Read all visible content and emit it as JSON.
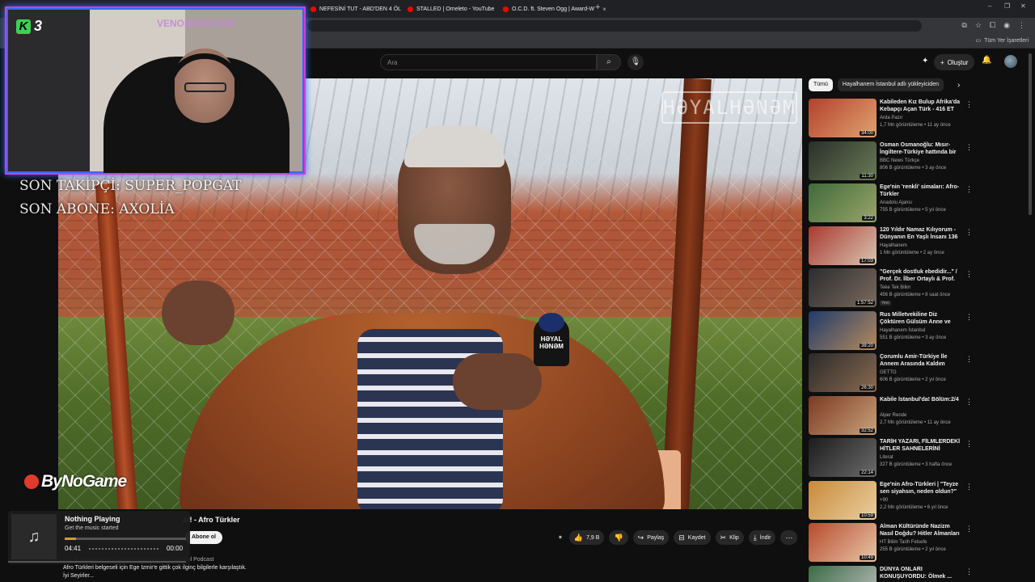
{
  "browser": {
    "tabs": [
      {
        "title": "NEFESİNİ TUT - ABD'DEN 4 ÖL"
      },
      {
        "title": "STALLED | Omeleto - YouTube"
      },
      {
        "title": "O.C.D. ft. Steven Ogg | Award-W"
      }
    ],
    "tab_close": "×",
    "new_tab": "+",
    "window_controls": {
      "minimize": "–",
      "restore": "❐",
      "close": "✕"
    },
    "bookmarks_label": "Tüm Yer İşaretleri"
  },
  "youtube": {
    "search_placeholder": "Ara",
    "create_label": "Oluştur",
    "video_watermark": "HƏYALHƏNƏM",
    "mic_flag": "HƏYAL HƏNƏM",
    "video_title": "ar! - Afro Türkler",
    "subscribe_label": "Abone ol",
    "actions": [
      {
        "icon": "like-icon",
        "glyph": "👍",
        "label": "7,9 B"
      },
      {
        "icon": "dislike-icon",
        "glyph": "👎",
        "label": ""
      },
      {
        "icon": "share-icon",
        "glyph": "↪",
        "label": "Paylaş"
      },
      {
        "icon": "save-icon",
        "glyph": "⊟",
        "label": "Kaydet"
      },
      {
        "icon": "clip-icon",
        "glyph": "✂",
        "label": "Klip"
      },
      {
        "icon": "download-icon",
        "glyph": "⤓",
        "label": "İndir"
      },
      {
        "icon": "more-icon",
        "glyph": "⋯",
        "label": ""
      }
    ],
    "description_meta": "574 B görüntüleme  2 ay önce  Hayalhanem İstanbul Podcast",
    "description_line1": "Afro Türkleri belgeseli için Ege İzmir'e gittik çok ilginç bilgilerle karşılaştık.",
    "description_line2": "İyi Seyirler..."
  },
  "stream_overlay": {
    "kick_number": "3",
    "kick_letter": "K",
    "channel_name": "VENOMSOKHAN",
    "last_follower": "SON TAKİPÇİ: SUPER_POPGAT",
    "last_subscriber": "SON ABONE: AXOLİA",
    "sponsor": "ByNoGame"
  },
  "now_playing": {
    "title": "Nothing Playing",
    "subtitle": "Get the music started",
    "elapsed": "04:41",
    "total": "00:00",
    "progress": 0.09
  },
  "sidebar": {
    "chips": [
      "Tümü",
      "Hayalhanem İstanbul adlı yükleyiciden"
    ],
    "recommendations": [
      {
        "title": "Kabileden Kız Bulup Afrika'da Kebapçı Açan Türk - 416 ET",
        "channel": "Arda Pazır",
        "meta": "1,7 Mn görüntüleme • 11 ay önce",
        "duration": "34:00",
        "c1": "#b3412c",
        "c2": "#e0a36f"
      },
      {
        "title": "Osman Osmanoğlu: Mısır-İngiltere-Türkiye hattında bir ...",
        "channel": "BBC News Türkçe",
        "meta": "806 B görüntüleme • 3 ay önce",
        "duration": "11:30",
        "c1": "#2a2f2a",
        "c2": "#6a7b55"
      },
      {
        "title": "Ege'nin 'renkli' simaları: Afro-Türkler",
        "channel": "Anadolu Ajansı",
        "meta": "755 B görüntüleme • 5 yıl önce",
        "duration": "3:22",
        "c1": "#3f6b3a",
        "c2": "#9aa46a"
      },
      {
        "title": "120 Yıldır Namaz Kılıyorum - Dünyanın En Yaşlı İnsanı 136 ...",
        "channel": "Hayalhanem",
        "meta": "1 Mn görüntüleme • 2 ay önce",
        "duration": "17:03",
        "c1": "#a93a30",
        "c2": "#d9c4b0"
      },
      {
        "title": "\"Gerçek dostluk ebedidir...\" / Prof. Dr. İlber Ortaylı & Prof. Dr...",
        "channel": "Teke Tek Bilim",
        "meta": "456 B görüntüleme • 8 saat önce",
        "duration": "1:57:52",
        "badge": "Yeni",
        "c1": "#2c2c30",
        "c2": "#7a6a5c"
      },
      {
        "title": "Rus Milletvekiline Diz Çöktüren Gülsüm Anne ve Umut'un ...",
        "channel": "Hayalhanem İstanbul",
        "meta": "551 B görüntüleme • 3 ay önce",
        "duration": "38:20",
        "c1": "#1f3b6b",
        "c2": "#b58a5c"
      },
      {
        "title": "Çorumlu Amir-Türkiye İle Annem Arasında Kaldım",
        "channel": "GETTO",
        "meta": "606 B görüntüleme • 2 yıl önce",
        "duration": "26:30",
        "c1": "#2a2a2a",
        "c2": "#8a6a50"
      },
      {
        "title": "Kabile İstanbul'da! Bölüm:2/4",
        "channel": "Alper Rende",
        "meta": "2,7 Mn görüntüleme • 11 ay önce",
        "duration": "32:52",
        "c1": "#7c3a22",
        "c2": "#c9a27a"
      },
      {
        "title": "TARİH YAZARI, FİLMLERDEKİ HİTLER SAHNELERİNİ İZLİYOR!",
        "channel": "Literat",
        "meta": "327 B görüntüleme • 3 hafta önce",
        "duration": "22:14",
        "c1": "#1c1c1c",
        "c2": "#6b6b6b"
      },
      {
        "title": "Ege'nin Afro-Türkleri | \"Teyze sen siyahsın, neden oldun?\"",
        "channel": "+90",
        "meta": "2,2 Mn görüntüleme • 6 yıl önce",
        "duration": "10:59",
        "c1": "#c98a3a",
        "c2": "#e9cfa0"
      },
      {
        "title": "Alman Kültüründe Nazizm Nasıl Doğdu? Hitler Almanları Hangi...",
        "channel": "HT Bilim Tarih Felsefe",
        "meta": "255 B görüntüleme • 2 yıl önce",
        "duration": "10:49",
        "c1": "#b84a2e",
        "c2": "#e7c6a6"
      },
      {
        "title": "DÜNYA ONLARI KONUŞUYORDU: Ölmek ...",
        "channel": "",
        "meta": "",
        "duration": "",
        "c1": "#3a6b45",
        "c2": "#c0c0c0"
      }
    ]
  }
}
